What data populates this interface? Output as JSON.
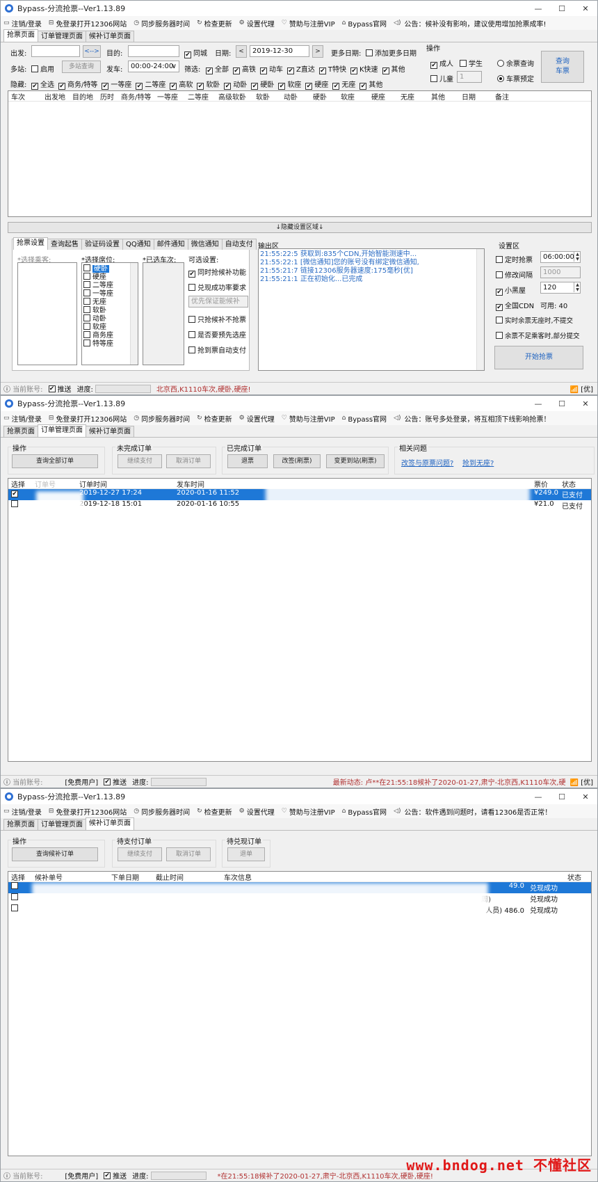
{
  "app": {
    "title": "Bypass-分流抢票--Ver1.13.89",
    "minimize": "—",
    "maximize": "☐",
    "close": "✕"
  },
  "menu": [
    {
      "icon": "monitor-icon",
      "glyph": "▭",
      "label": "注销/登录"
    },
    {
      "icon": "browser-icon",
      "glyph": "⊟",
      "label": "免登录打开12306网站"
    },
    {
      "icon": "clock-icon",
      "glyph": "◷",
      "label": "同步服务器时间"
    },
    {
      "icon": "refresh-icon",
      "glyph": "↻",
      "label": "检查更新"
    },
    {
      "icon": "gear-icon",
      "glyph": "⚙",
      "label": "设置代理"
    },
    {
      "icon": "heart-icon",
      "glyph": "♡",
      "label": "赞助与注册VIP"
    },
    {
      "icon": "home-icon",
      "glyph": "⌂",
      "label": "Bypass官网"
    },
    {
      "icon": "speaker-icon",
      "glyph": "◁)",
      "label": ""
    }
  ],
  "announcements": {
    "w1": "公告：候补没有影响，建议使用增加抢票成率!",
    "w2": "公告：账号多处登录，将互相顶下线影响抢票！",
    "w3": "公告：软件遇到问题时，请看12306是否正常！"
  },
  "tabs": [
    "抢票页面",
    "订单管理页面",
    "候补订单页面"
  ],
  "search": {
    "from_label": "出发:",
    "swap": "<-->",
    "to_label": "目的:",
    "same_city": "同城",
    "date_label": "日期:",
    "prev": "<",
    "date": "2019-12-30",
    "next": ">",
    "more_dates_label": "更多日期:",
    "add_dates": "添加更多日期",
    "multi_label": "多站:",
    "enable": "启用",
    "multi_query": "多站查询",
    "depart_label": "发车:",
    "depart_time": "00:00-24:00",
    "dropdown": "∨",
    "filter_label": "筛选:",
    "filters": [
      "全部",
      "高铁",
      "动车",
      "Z直达",
      "T特快",
      "K快速",
      "其他"
    ],
    "hide_label": "隐藏:",
    "hide": [
      "全选",
      "商务/特等",
      "一等座",
      "二等座",
      "高软",
      "软卧",
      "动卧",
      "硬卧",
      "软座",
      "硬座",
      "无座",
      "其他"
    ]
  },
  "ops": {
    "title": "操作",
    "adult": "成人",
    "student": "学生",
    "child": "儿童",
    "child_count": "1",
    "remain": "余票查询",
    "reserve": "车票预定",
    "query_btn_1": "查询",
    "query_btn_2": "车票"
  },
  "train_columns": [
    "车次",
    "出发地",
    "目的地",
    "历时",
    "商务/特等",
    "一等座",
    "二等座",
    "高级软卧",
    "软卧",
    "动卧",
    "硬卧",
    "软座",
    "硬座",
    "无座",
    "其他",
    "日期",
    "备注"
  ],
  "hidden_area": "↓隐藏设置区域↓",
  "settings_tabs": [
    "抢票设置",
    "查询起售",
    "验证码设置",
    "QQ通知",
    "邮件通知",
    "微信通知",
    "自动支付"
  ],
  "passenger_label": "*选择乘客:",
  "seat_label": "*选择席位:",
  "seats": [
    "硬卧",
    "硬座",
    "二等座",
    "一等座",
    "无座",
    "软卧",
    "动卧",
    "软座",
    "商务座",
    "特等座"
  ],
  "selected_train_label": "*已选车次:",
  "optional": {
    "title": "可选设置:",
    "both": "同时抢候补功能",
    "rate": "兑现成功率要求",
    "priority": "优先保证能候补",
    "only": "只抢候补不抢票",
    "preselect": "是否要预先选座",
    "autopay": "抢到票自动支付"
  },
  "output": {
    "title": "输出区",
    "lines": [
      "21:55:22:5  获取到:835个CDN,开始智能测速中...",
      "21:55:22:1  [微信通知]您的账号没有绑定微信通知,",
      "21:55:21:7  链接12306服务器速度:175毫秒[优]",
      "21:55:21:1  正在初始化...已完成"
    ]
  },
  "settings": {
    "title": "设置区",
    "timed": "定时抢票",
    "timed_val": "06:00:00",
    "interval": "修改间隔",
    "interval_val": "1000",
    "blacklist": "小黑屋",
    "blacklist_val": "120",
    "cdn": "全国CDN",
    "cdn_avail": "可用: 40",
    "no_submit": "实时余票无座时,不提交",
    "partial": "余票不足乘客时,部分提交",
    "start": "开始抢票"
  },
  "status": {
    "account": "当前账号:",
    "user": "[免费用户]",
    "push": "推送",
    "progress": "进度:",
    "news_label": "最新动态:",
    "news_w1": "北京西,K1110车次,硬卧,硬座!",
    "news_w2": "卢**在21:55:18候补了2020-01-27,肃宁-北京西,K1110车次,硬",
    "news_w3": "*在21:55:18候补了2020-01-27,肃宁-北京西,K1110车次,硬卧,硬座!",
    "wifi": "📶",
    "excellent": "[优]"
  },
  "orders": {
    "ops_title": "操作",
    "query_all": "查询全部订单",
    "pending_title": "未完成订单",
    "continue_pay": "继续支付",
    "cancel": "取消订单",
    "done_title": "已完成订单",
    "refund": "退票",
    "change": "改签(刷票)",
    "change_station": "变更到站(刷票)",
    "related_title": "相关问题",
    "q1": "改签与原票问题?",
    "q2": "抢到无座?",
    "columns": [
      "选择",
      "订单号",
      "订单时间",
      "发车时间",
      "票价",
      "状态"
    ],
    "rows": [
      {
        "checked": "✔",
        "time": "2019-12-27 17:24",
        "depart": "2020-01-16 11:52",
        "price": "¥249.0",
        "status": "已支付"
      },
      {
        "checked": "",
        "time": "2019-12-18 15:01",
        "depart": "2020-01-16 10:55",
        "price": "¥21.0",
        "status": "已支付"
      }
    ]
  },
  "waitlist": {
    "ops_title": "操作",
    "query": "查询候补订单",
    "pay_title": "待支付订单",
    "continue_pay": "继续支付",
    "cancel": "取消订单",
    "cash_title": "待兑现订单",
    "refund": "退单",
    "columns": [
      "选择",
      "候补单号",
      "下单日期",
      "截止时间",
      "车次信息",
      "状态"
    ],
    "rows": [
      {
        "tail": "49.0",
        "status": "兑现成功"
      },
      {
        "tail": "周)",
        "status": "兑现成功"
      },
      {
        "tail": "人员)  486.0",
        "status": "兑现成功"
      }
    ]
  },
  "watermark": "www.bndog.net 不懂社区"
}
